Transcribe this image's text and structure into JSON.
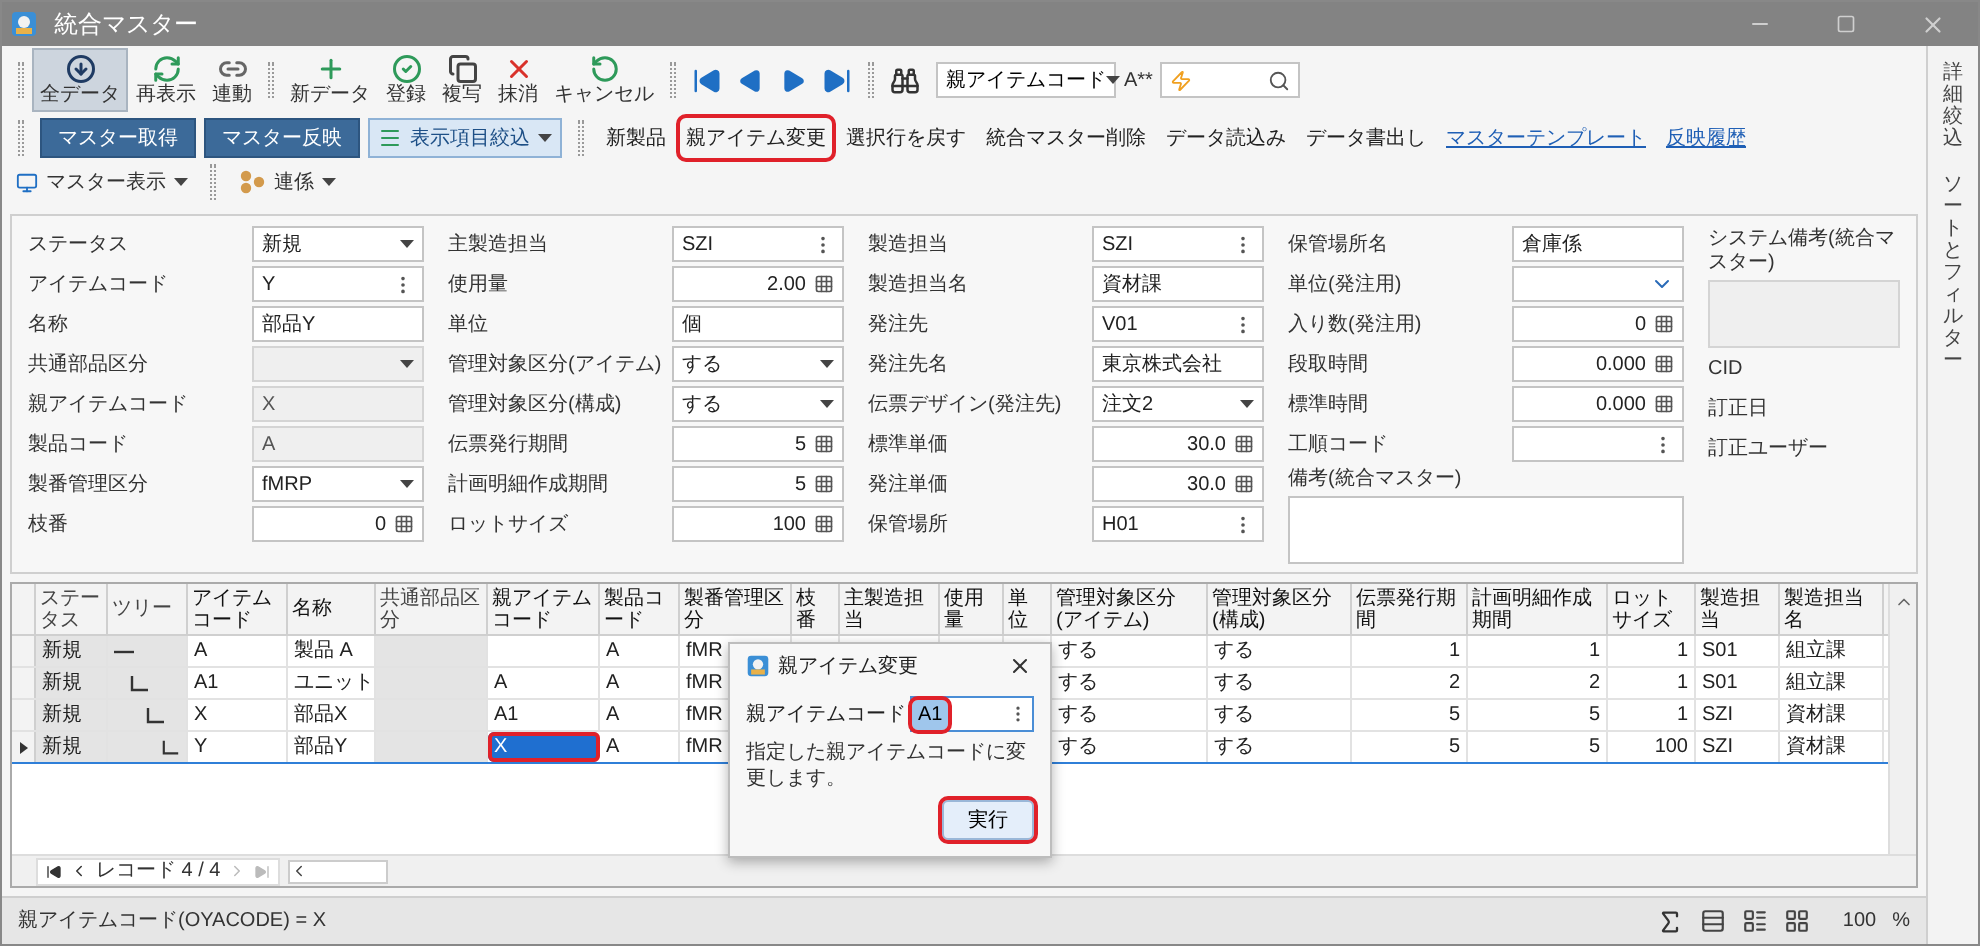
{
  "window": {
    "title": "統合マスター"
  },
  "toolbar": {
    "groups": [
      [
        {
          "kind": "download",
          "label": "全データ",
          "selected": true
        },
        {
          "kind": "refresh",
          "label": "再表示",
          "selected": false
        },
        {
          "kind": "link",
          "label": "連動",
          "selected": false
        }
      ],
      [
        {
          "kind": "new",
          "label": "新データ",
          "selected": false
        },
        {
          "kind": "save",
          "label": "登録",
          "selected": false
        },
        {
          "kind": "copy",
          "label": "複写",
          "selected": false
        },
        {
          "kind": "delete",
          "label": "抹消",
          "selected": false
        },
        {
          "kind": "cancel",
          "label": "キャンセル",
          "selected": false
        }
      ]
    ],
    "search_column": "親アイテムコード",
    "match_label": "A**"
  },
  "actions": [
    {
      "kind": "primary",
      "label": "マスター取得",
      "highlighted": false
    },
    {
      "kind": "primary",
      "label": "マスター反映",
      "highlighted": false
    },
    {
      "kind": "filter",
      "label": "表示項目絞込",
      "highlighted": false
    },
    {
      "kind": "text",
      "label": "新製品",
      "highlighted": false
    },
    {
      "kind": "text",
      "label": "親アイテム変更",
      "highlighted": true
    },
    {
      "kind": "text",
      "label": "選択行を戻す",
      "highlighted": false
    },
    {
      "kind": "text",
      "label": "統合マスター削除",
      "highlighted": false
    },
    {
      "kind": "text",
      "label": "データ読込み",
      "highlighted": false
    },
    {
      "kind": "text",
      "label": "データ書出し",
      "highlighted": false
    },
    {
      "kind": "link",
      "label": "マスターテンプレート",
      "highlighted": false
    },
    {
      "kind": "link",
      "label": "反映履歴",
      "highlighted": false
    },
    {
      "kind": "view",
      "label": "マスター表示",
      "highlighted": false
    },
    {
      "kind": "collab",
      "label": "連係",
      "highlighted": false
    }
  ],
  "form": {
    "columns": [
      [
        {
          "label": "ステータス",
          "kind": "combo",
          "value": "新規",
          "disabled": false
        },
        {
          "label": "アイテムコード",
          "kind": "lookup",
          "value": "Y",
          "disabled": false
        },
        {
          "label": "名称",
          "kind": "text",
          "value": "部品Y",
          "disabled": false
        },
        {
          "label": "共通部品区分",
          "kind": "combo",
          "disabled": true
        },
        {
          "label": "親アイテムコード",
          "kind": "text",
          "value": "X",
          "disabled": true
        },
        {
          "label": "製品コード",
          "kind": "text",
          "value": "A",
          "disabled": true
        },
        {
          "label": "製番管理区分",
          "kind": "combo",
          "value": "fMRP",
          "disabled": false
        },
        {
          "label": "枝番",
          "kind": "number",
          "value": "0",
          "disabled": false
        }
      ],
      [
        {
          "label": "主製造担当",
          "kind": "lookup",
          "value": "SZI",
          "disabled": false
        },
        {
          "label": "使用量",
          "kind": "number",
          "value": "2.00",
          "disabled": false
        },
        {
          "label": "単位",
          "kind": "text",
          "value": "個",
          "disabled": false
        },
        {
          "label": "管理対象区分(アイテム)",
          "kind": "combo",
          "value": "する",
          "disabled": false
        },
        {
          "label": "管理対象区分(構成)",
          "kind": "combo",
          "value": "する",
          "disabled": false
        },
        {
          "label": "伝票発行期間",
          "kind": "number",
          "value": "5",
          "disabled": false
        },
        {
          "label": "計画明細作成期間",
          "kind": "number",
          "value": "5",
          "disabled": false
        },
        {
          "label": "ロットサイズ",
          "kind": "number",
          "value": "100",
          "disabled": false
        }
      ],
      [
        {
          "label": "製造担当",
          "kind": "lookup",
          "value": "SZI",
          "disabled": false
        },
        {
          "label": "製造担当名",
          "kind": "text",
          "value": "資材課",
          "disabled": false
        },
        {
          "label": "発注先",
          "kind": "lookup",
          "value": "V01",
          "disabled": false
        },
        {
          "label": "発注先名",
          "kind": "text",
          "value": "東京株式会社",
          "disabled": false
        },
        {
          "label": "伝票デザイン(発注先)",
          "kind": "combo",
          "value": "注文2",
          "disabled": false
        },
        {
          "label": "標準単価",
          "kind": "number",
          "value": "30.0",
          "disabled": false
        },
        {
          "label": "発注単価",
          "kind": "number",
          "value": "30.0",
          "disabled": false
        },
        {
          "label": "保管場所",
          "kind": "lookup",
          "value": "H01",
          "disabled": false
        }
      ],
      [
        {
          "label": "保管場所名",
          "kind": "text",
          "value": "倉庫係",
          "disabled": false
        },
        {
          "label": "単位(発注用)",
          "kind": "select",
          "disabled": false
        },
        {
          "label": "入り数(発注用)",
          "kind": "number",
          "value": "0",
          "disabled": false
        },
        {
          "label": "段取時間",
          "kind": "number",
          "value": "0.000",
          "disabled": false
        },
        {
          "label": "標準時間",
          "kind": "number",
          "value": "0.000",
          "disabled": false
        },
        {
          "label": "工順コード",
          "kind": "lookup",
          "disabled": false
        },
        {
          "label": "備考(統合マスター)",
          "kind": "memo",
          "disabled": false
        }
      ],
      [
        {
          "label": "システム備考(統合マスター)",
          "kind": "memo",
          "disabled": true
        },
        {
          "label": "CID",
          "kind": "info"
        },
        {
          "label": "訂正日",
          "kind": "info"
        },
        {
          "label": "訂正ユーザー",
          "kind": "info"
        }
      ]
    ]
  },
  "grid": {
    "cell_highlighted": true,
    "columns": [
      {
        "label": "ステータス",
        "kind": "text",
        "readonly": true
      },
      {
        "label": "ツリー",
        "kind": "tree",
        "readonly": true
      },
      {
        "label": "アイテムコード",
        "kind": "text",
        "readonly": false
      },
      {
        "label": "名称",
        "kind": "text",
        "readonly": false
      },
      {
        "label": "共通部品区分",
        "kind": "text",
        "readonly": true
      },
      {
        "label": "親アイテムコード",
        "kind": "text",
        "readonly": false
      },
      {
        "label": "製品コード",
        "kind": "text",
        "readonly": false
      },
      {
        "label": "製番管理区分",
        "kind": "text",
        "readonly": false
      },
      {
        "label": "枝番",
        "kind": "number",
        "readonly": false
      },
      {
        "label": "主製造担当",
        "kind": "text",
        "readonly": false
      },
      {
        "label": "使用量",
        "kind": "number",
        "readonly": false
      },
      {
        "label": "単位",
        "kind": "text",
        "readonly": false
      },
      {
        "label": "管理対象区分(アイテム)",
        "kind": "text",
        "readonly": false
      },
      {
        "label": "管理対象区分(構成)",
        "kind": "text",
        "readonly": false
      },
      {
        "label": "伝票発行期間",
        "kind": "number",
        "readonly": false
      },
      {
        "label": "計画明細作成期間",
        "kind": "number",
        "readonly": false
      },
      {
        "label": "ロットサイズ",
        "kind": "number",
        "readonly": false
      },
      {
        "label": "製造担当",
        "kind": "text",
        "readonly": false
      },
      {
        "label": "製造担当名",
        "kind": "text",
        "readonly": false
      }
    ],
    "rows": [
      {
        "selected": false,
        "cells": [
          {
            "text": "新規",
            "selected": false
          },
          {
            "selected": false
          },
          {
            "text": "A",
            "selected": false
          },
          {
            "text": "製品 A",
            "selected": false
          },
          {
            "selected": false
          },
          {
            "selected": false
          },
          {
            "text": "A",
            "selected": false
          },
          {
            "text": "fMR",
            "selected": false
          },
          null,
          null,
          null,
          null,
          {
            "text": "する",
            "selected": false
          },
          {
            "text": "する",
            "selected": false
          },
          {
            "text": "1",
            "selected": false
          },
          {
            "text": "1",
            "selected": false
          },
          {
            "text": "1",
            "selected": false
          },
          {
            "text": "S01",
            "selected": false
          },
          {
            "text": "組立課",
            "selected": false
          }
        ],
        "children": [
          {
            "selected": false,
            "cells": [
              {
                "text": "新規",
                "selected": false
              },
              {
                "selected": false
              },
              {
                "text": "A1",
                "selected": false
              },
              {
                "text": "ユニット",
                "selected": false
              },
              {
                "selected": false
              },
              {
                "text": "A",
                "selected": false
              },
              {
                "text": "A",
                "selected": false
              },
              {
                "text": "fMR",
                "selected": false
              },
              null,
              null,
              null,
              null,
              {
                "text": "する",
                "selected": false
              },
              {
                "text": "する",
                "selected": false
              },
              {
                "text": "2",
                "selected": false
              },
              {
                "text": "2",
                "selected": false
              },
              {
                "text": "1",
                "selected": false
              },
              {
                "text": "S01",
                "selected": false
              },
              {
                "text": "組立課",
                "selected": false
              }
            ],
            "children": [
              {
                "selected": false,
                "cells": [
                  {
                    "text": "新規",
                    "selected": false
                  },
                  {
                    "selected": false
                  },
                  {
                    "text": "X",
                    "selected": false
                  },
                  {
                    "text": "部品X",
                    "selected": false
                  },
                  {
                    "selected": false
                  },
                  {
                    "text": "A1",
                    "selected": false
                  },
                  {
                    "text": "A",
                    "selected": false
                  },
                  {
                    "text": "fMR",
                    "selected": false
                  },
                  null,
                  null,
                  null,
                  null,
                  {
                    "text": "する",
                    "selected": false
                  },
                  {
                    "text": "する",
                    "selected": false
                  },
                  {
                    "text": "5",
                    "selected": false
                  },
                  {
                    "text": "5",
                    "selected": false
                  },
                  {
                    "text": "1",
                    "selected": false
                  },
                  {
                    "text": "SZI",
                    "selected": false
                  },
                  {
                    "text": "資材課",
                    "selected": false
                  }
                ],
                "children": [
                  {
                    "selected": true,
                    "cells": [
                      {
                        "text": "新規",
                        "selected": false
                      },
                      {
                        "selected": false
                      },
                      {
                        "text": "Y",
                        "selected": false
                      },
                      {
                        "text": "部品Y",
                        "selected": false
                      },
                      {
                        "selected": false
                      },
                      {
                        "text": "X",
                        "selected": true
                      },
                      {
                        "text": "A",
                        "selected": false
                      },
                      {
                        "text": "fMR",
                        "selected": false
                      },
                      null,
                      null,
                      null,
                      null,
                      {
                        "text": "する",
                        "selected": false
                      },
                      {
                        "text": "する",
                        "selected": false
                      },
                      {
                        "text": "5",
                        "selected": false
                      },
                      {
                        "text": "5",
                        "selected": false
                      },
                      {
                        "text": "100",
                        "selected": false
                      },
                      {
                        "text": "SZI",
                        "selected": false
                      },
                      {
                        "text": "資材課",
                        "selected": false
                      }
                    ]
                  }
                ]
              }
            ]
          }
        ]
      }
    ],
    "record_label": "レコード 4 / 4"
  },
  "dialog": {
    "title": "親アイテム変更",
    "field_label": "親アイテムコード",
    "field_value": "A1",
    "field_highlighted": true,
    "message": "指定した親アイテムコードに変更します。",
    "button": "実行",
    "button_highlighted": true
  },
  "side_tabs": [
    "詳細絞込",
    "ソートとフィルター"
  ],
  "status_bar": {
    "filter": "親アイテムコード(OYACODE) = X",
    "zoom": "100",
    "zoom_unit": "%"
  }
}
